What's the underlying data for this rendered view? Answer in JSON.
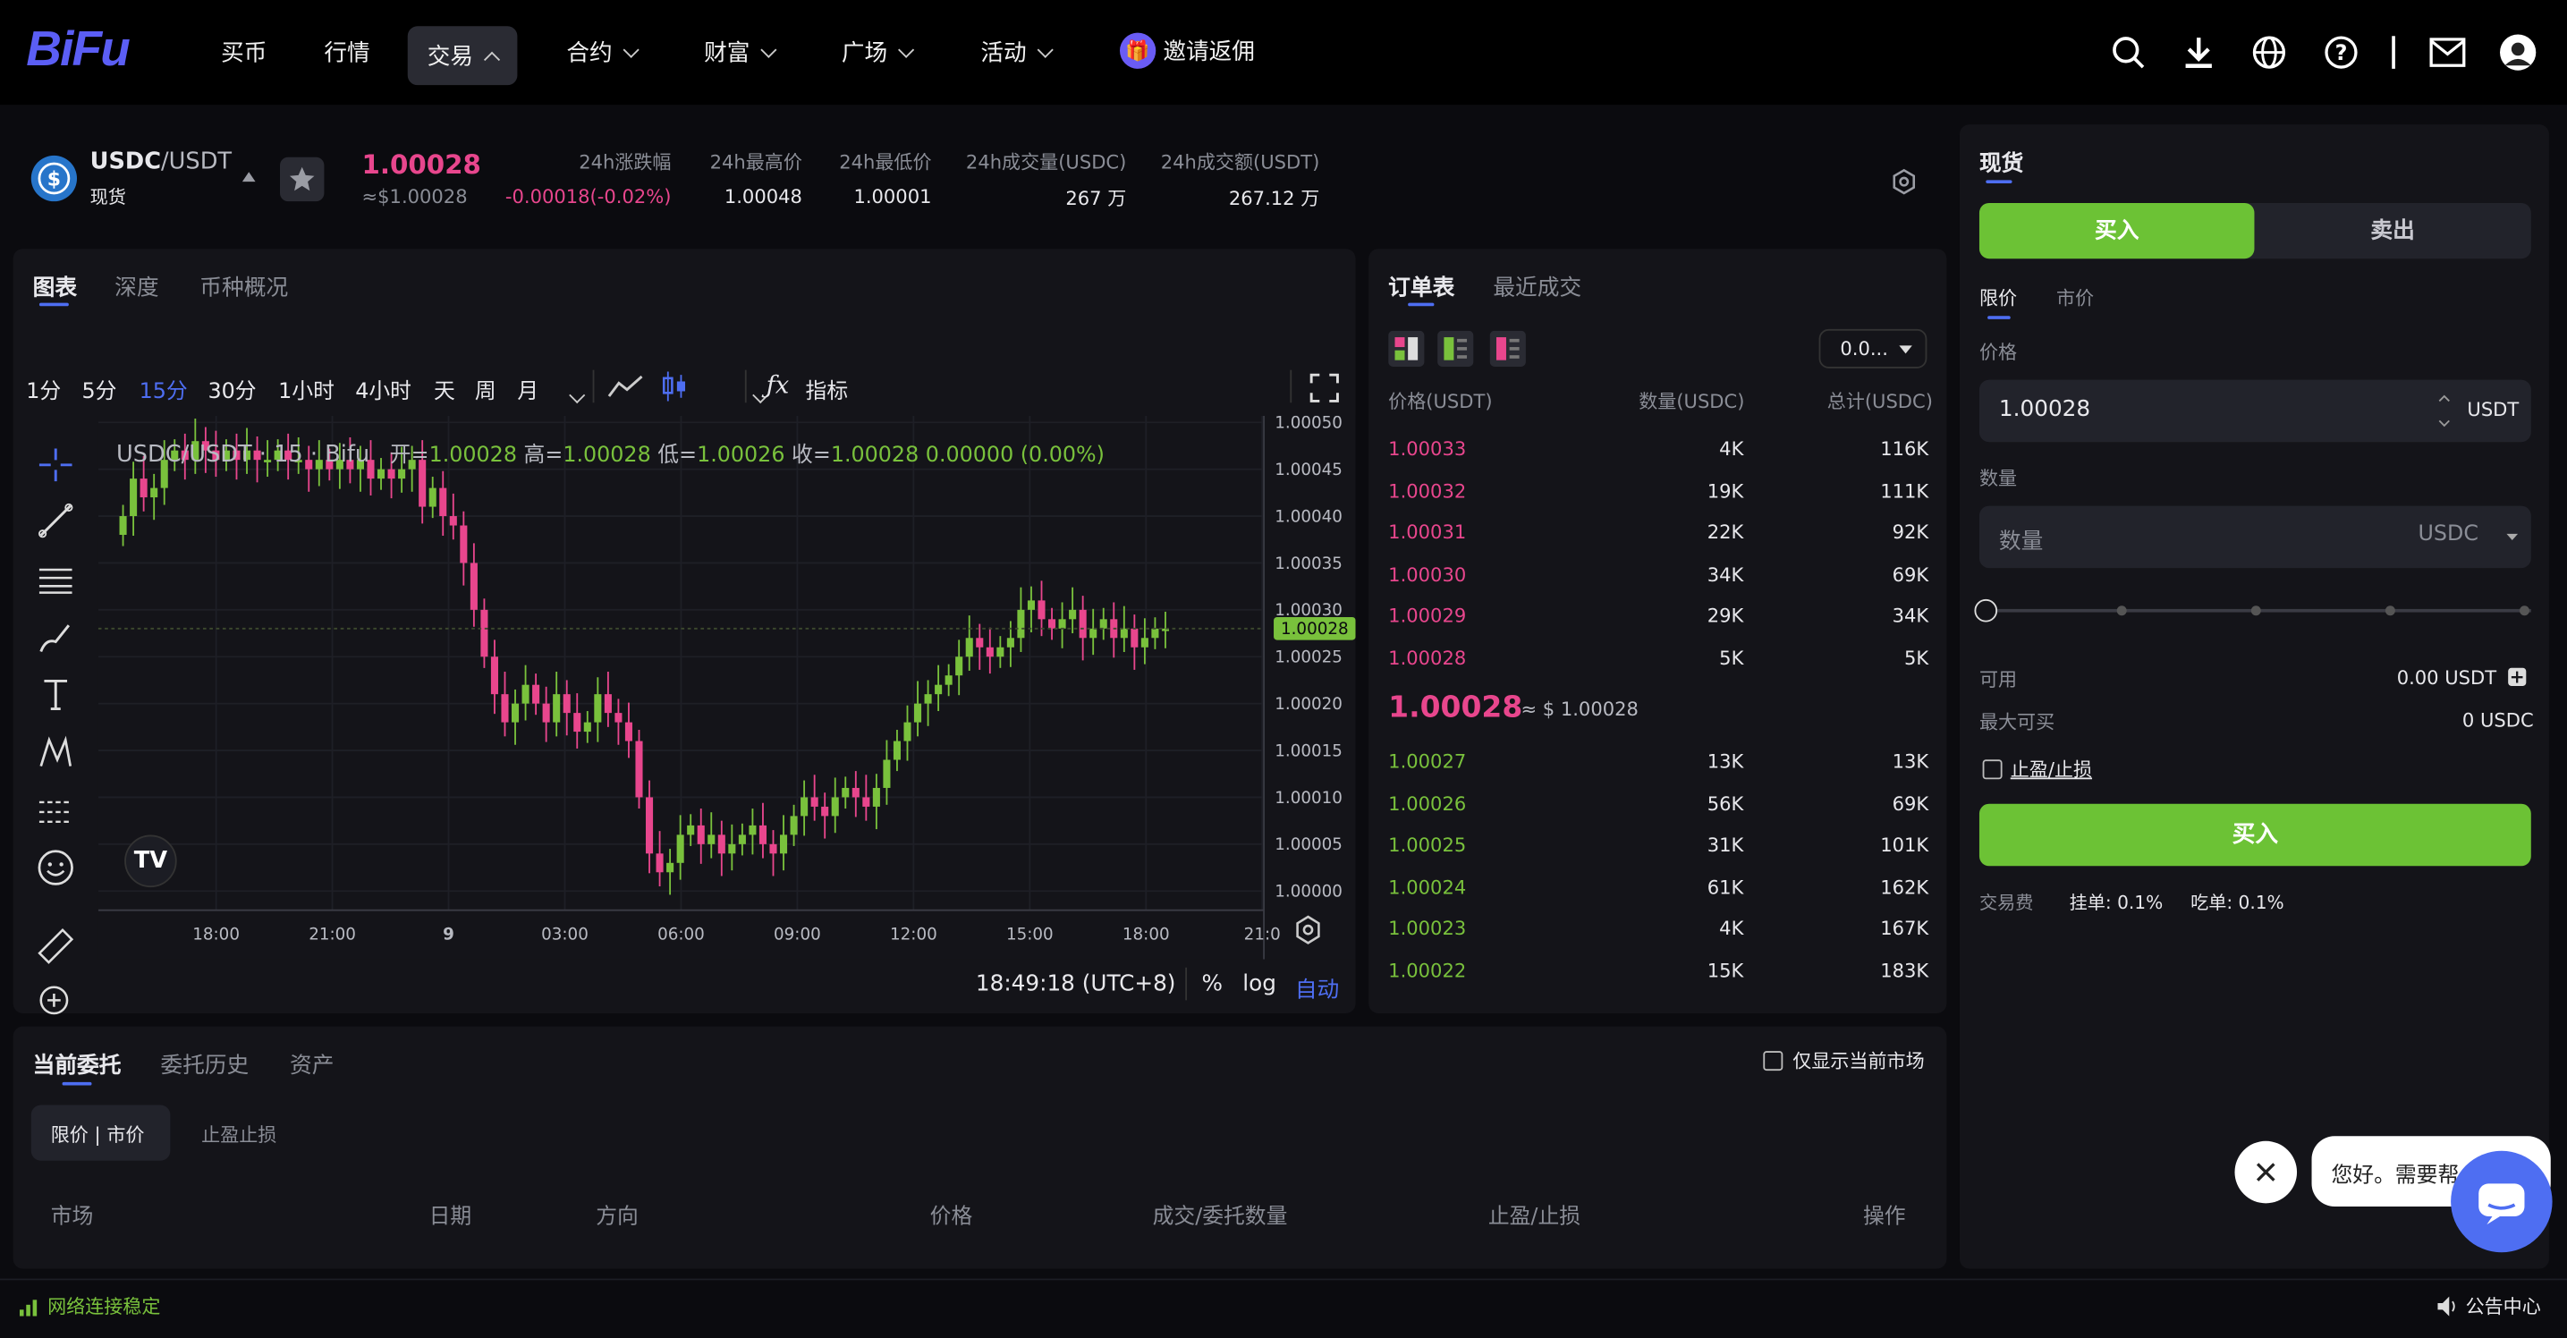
{
  "nav": {
    "logo": "BiFu",
    "items": [
      "买币",
      "行情",
      "交易",
      "合约",
      "财富",
      "广场",
      "活动"
    ],
    "invite": "邀请返佣"
  },
  "ticker": {
    "pair_base": "USDC",
    "pair_quote": "/USDT",
    "market_type": "现货",
    "last_price": "1.00028",
    "last_price_usd": "≈$1.00028",
    "stats": [
      {
        "label": "24h涨跌幅",
        "value": "-0.00018(-0.02%)"
      },
      {
        "label": "24h最高价",
        "value": "1.00048"
      },
      {
        "label": "24h最低价",
        "value": "1.00001"
      },
      {
        "label": "24h成交量(USDC)",
        "value": "267 万"
      },
      {
        "label": "24h成交额(USDT)",
        "value": "267.12 万"
      }
    ]
  },
  "chart_panel": {
    "tabs": [
      "图表",
      "深度",
      "币种概况"
    ],
    "intervals": [
      "1分",
      "5分",
      "15分",
      "30分",
      "1小时",
      "4小时",
      "天",
      "周",
      "月"
    ],
    "active_interval": "15分",
    "indicator_label": "指标",
    "legend": {
      "title": "USDC/USDT · 15 · Bifu",
      "open_label": "开=",
      "open": "1.00028",
      "high_label": "高=",
      "high": "1.00028",
      "low_label": "低=",
      "low": "1.00026",
      "close_label": "收=",
      "close": "1.00028",
      "change": "0.00000 (0.00%)"
    },
    "clock": "18:49:18 (UTC+8)",
    "pct": "%",
    "log": "log",
    "auto": "自动"
  },
  "chart_data": {
    "type": "candlestick",
    "title": "USDC/USDT · 15 · Bifu",
    "x_ticks": [
      "18:00",
      "21:00",
      "9",
      "03:00",
      "06:00",
      "09:00",
      "12:00",
      "15:00",
      "18:00",
      "21:0"
    ],
    "y_ticks": [
      "1.00050",
      "1.00045",
      "1.00040",
      "1.00035",
      "1.00030",
      "1.00025",
      "1.00020",
      "1.00015",
      "1.00010",
      "1.00005",
      "1.00000"
    ],
    "y_range": [
      0.99999,
      1.0005
    ],
    "current_price": "1.00028",
    "closes": [
      1.0004,
      1.00044,
      1.00042,
      1.00043,
      1.00046,
      1.00047,
      1.00046,
      1.00048,
      1.00047,
      1.00046,
      1.00047,
      1.00046,
      1.00047,
      1.00046,
      1.00046,
      1.00047,
      1.00046,
      1.00046,
      1.00045,
      1.00046,
      1.00045,
      1.00046,
      1.00045,
      1.00046,
      1.00044,
      1.00045,
      1.00044,
      1.00045,
      1.00046,
      1.00041,
      1.00043,
      1.0004,
      1.00039,
      1.00035,
      1.0003,
      1.00025,
      1.00021,
      1.00018,
      1.0002,
      1.00022,
      1.0002,
      1.00018,
      1.00021,
      1.00019,
      1.00017,
      1.00018,
      1.00021,
      1.00019,
      1.00018,
      1.00016,
      1.0001,
      1.00004,
      1.00002,
      1.00003,
      1.00006,
      1.00007,
      1.00005,
      1.00006,
      1.00004,
      1.00005,
      1.00006,
      1.00007,
      1.00005,
      1.00004,
      1.00006,
      1.00008,
      1.0001,
      1.00009,
      1.00008,
      1.0001,
      1.00011,
      1.0001,
      1.00009,
      1.00011,
      1.00014,
      1.00016,
      1.00018,
      1.0002,
      1.00021,
      1.00022,
      1.00023,
      1.00025,
      1.00027,
      1.00026,
      1.00025,
      1.00026,
      1.00027,
      1.0003,
      1.00031,
      1.00029,
      1.00028,
      1.00029,
      1.0003,
      1.00027,
      1.00028,
      1.00029,
      1.00027,
      1.00028,
      1.00026,
      1.00027,
      1.00028,
      1.00028
    ]
  },
  "orderbook": {
    "tabs": [
      "订单表",
      "最近成交"
    ],
    "precision": "0.0...",
    "headers": [
      "价格(USDT)",
      "数量(USDC)",
      "总计(USDC)"
    ],
    "asks": [
      {
        "price": "1.00033",
        "qty": "4K",
        "total": "116K"
      },
      {
        "price": "1.00032",
        "qty": "19K",
        "total": "111K"
      },
      {
        "price": "1.00031",
        "qty": "22K",
        "total": "92K"
      },
      {
        "price": "1.00030",
        "qty": "34K",
        "total": "69K"
      },
      {
        "price": "1.00029",
        "qty": "29K",
        "total": "34K"
      },
      {
        "price": "1.00028",
        "qty": "5K",
        "total": "5K"
      }
    ],
    "mid_price": "1.00028",
    "mid_usd": "≈ $ 1.00028",
    "bids": [
      {
        "price": "1.00027",
        "qty": "13K",
        "total": "13K"
      },
      {
        "price": "1.00026",
        "qty": "56K",
        "total": "69K"
      },
      {
        "price": "1.00025",
        "qty": "31K",
        "total": "101K"
      },
      {
        "price": "1.00024",
        "qty": "61K",
        "total": "162K"
      },
      {
        "price": "1.00023",
        "qty": "4K",
        "total": "167K"
      },
      {
        "price": "1.00022",
        "qty": "15K",
        "total": "183K"
      }
    ]
  },
  "trade": {
    "title": "现货",
    "buy_tab": "买入",
    "sell_tab": "卖出",
    "order_types": [
      "限价",
      "市价"
    ],
    "price_label": "价格",
    "price_value": "1.00028",
    "price_unit": "USDT",
    "qty_label": "数量",
    "qty_placeholder": "数量",
    "qty_unit": "USDC",
    "available_label": "可用",
    "available_value": "0.00 USDT",
    "max_buy_label": "最大可买",
    "max_buy_value": "0 USDC",
    "tpsl_label": "止盈/止损",
    "buy_button": "买入",
    "fee_label": "交易费",
    "maker_fee": "挂单: 0.1%",
    "taker_fee": "吃单: 0.1%"
  },
  "orders": {
    "tabs": [
      "当前委托",
      "委托历史",
      "资产"
    ],
    "only_current": "仅显示当前市场",
    "subtabs": [
      "限价 | 市价",
      "止盈止损"
    ],
    "columns": [
      "市场",
      "日期",
      "方向",
      "价格",
      "成交/委托数量",
      "止盈/止损",
      "操作"
    ]
  },
  "chat": {
    "bubble": "您好。需要帮"
  },
  "status": {
    "connection": "网络连接稳定",
    "announcement": "公告中心"
  },
  "colors": {
    "accent": "#4e6ef2",
    "up": "#79c13c",
    "down": "#e8468d",
    "buy": "#6cc235"
  }
}
